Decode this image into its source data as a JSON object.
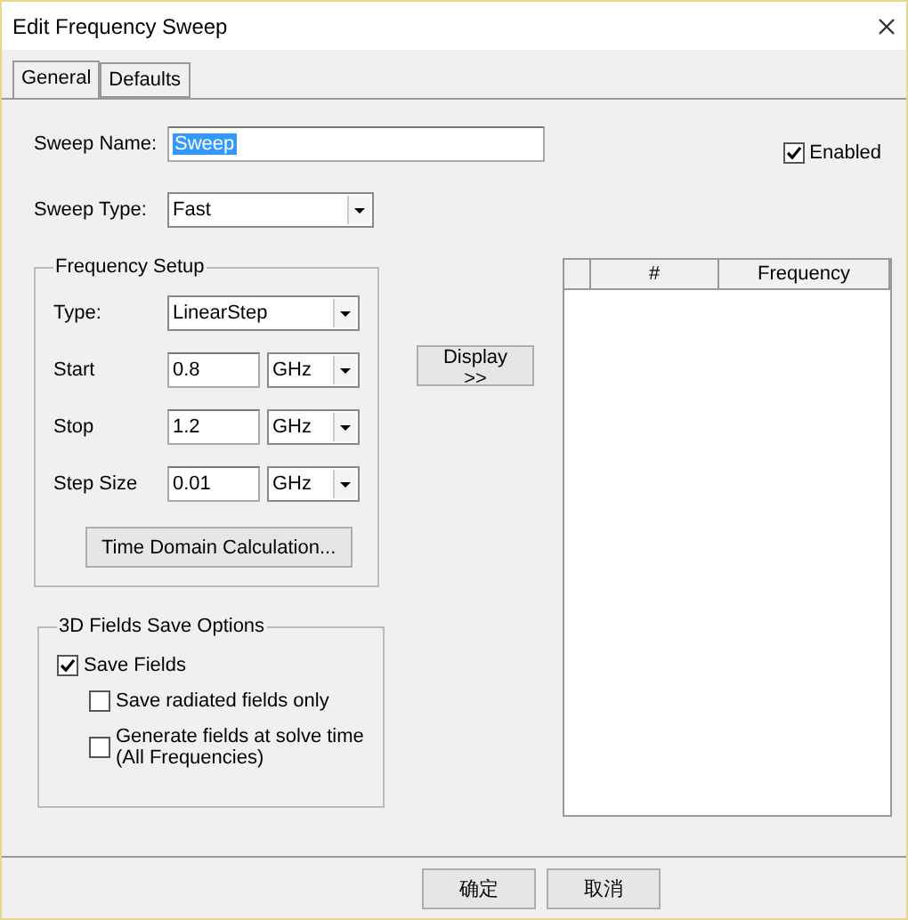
{
  "window": {
    "title": "Edit Frequency Sweep"
  },
  "tabs": [
    {
      "label": "General",
      "selected": true
    },
    {
      "label": "Defaults",
      "selected": false
    }
  ],
  "sweep_name": {
    "label": "Sweep Name:",
    "value": "Sweep",
    "text_selected": true
  },
  "enabled": {
    "label": "Enabled",
    "checked": true
  },
  "sweep_type": {
    "label": "Sweep Type:",
    "value": "Fast"
  },
  "frequency_setup": {
    "title": "Frequency Setup",
    "type": {
      "label": "Type:",
      "value": "LinearStep"
    },
    "rows": [
      {
        "label": "Start",
        "value": "0.8",
        "unit": "GHz"
      },
      {
        "label": "Stop",
        "value": "1.2",
        "unit": "GHz"
      },
      {
        "label": "Step Size",
        "value": "0.01",
        "unit": "GHz"
      }
    ],
    "button": "Time Domain Calculation..."
  },
  "display_button": "Display >>",
  "table": {
    "columns": [
      {
        "label": "#"
      },
      {
        "label": "Frequency"
      }
    ]
  },
  "fields_save": {
    "title": "3D Fields Save Options",
    "options": [
      {
        "label": "Save Fields",
        "checked": true,
        "children": [
          {
            "label": "Save radiated fields only",
            "checked": false
          },
          {
            "label": "Generate fields at solve time (All Frequencies)",
            "checked": false
          }
        ]
      }
    ]
  },
  "buttons": [
    "确定",
    "取消"
  ]
}
